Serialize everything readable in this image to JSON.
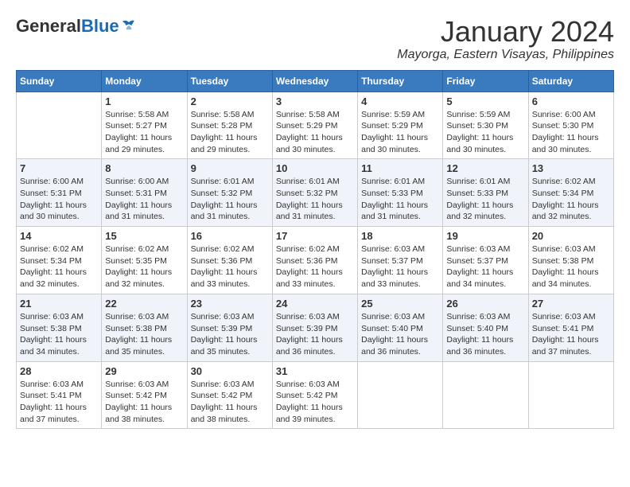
{
  "header": {
    "logo_general": "General",
    "logo_blue": "Blue",
    "month": "January 2024",
    "location": "Mayorga, Eastern Visayas, Philippines"
  },
  "days_of_week": [
    "Sunday",
    "Monday",
    "Tuesday",
    "Wednesday",
    "Thursday",
    "Friday",
    "Saturday"
  ],
  "weeks": [
    [
      {
        "day": "",
        "sunrise": "",
        "sunset": "",
        "daylight": ""
      },
      {
        "day": "1",
        "sunrise": "Sunrise: 5:58 AM",
        "sunset": "Sunset: 5:27 PM",
        "daylight": "Daylight: 11 hours and 29 minutes."
      },
      {
        "day": "2",
        "sunrise": "Sunrise: 5:58 AM",
        "sunset": "Sunset: 5:28 PM",
        "daylight": "Daylight: 11 hours and 29 minutes."
      },
      {
        "day": "3",
        "sunrise": "Sunrise: 5:58 AM",
        "sunset": "Sunset: 5:29 PM",
        "daylight": "Daylight: 11 hours and 30 minutes."
      },
      {
        "day": "4",
        "sunrise": "Sunrise: 5:59 AM",
        "sunset": "Sunset: 5:29 PM",
        "daylight": "Daylight: 11 hours and 30 minutes."
      },
      {
        "day": "5",
        "sunrise": "Sunrise: 5:59 AM",
        "sunset": "Sunset: 5:30 PM",
        "daylight": "Daylight: 11 hours and 30 minutes."
      },
      {
        "day": "6",
        "sunrise": "Sunrise: 6:00 AM",
        "sunset": "Sunset: 5:30 PM",
        "daylight": "Daylight: 11 hours and 30 minutes."
      }
    ],
    [
      {
        "day": "7",
        "sunrise": "Sunrise: 6:00 AM",
        "sunset": "Sunset: 5:31 PM",
        "daylight": "Daylight: 11 hours and 30 minutes."
      },
      {
        "day": "8",
        "sunrise": "Sunrise: 6:00 AM",
        "sunset": "Sunset: 5:31 PM",
        "daylight": "Daylight: 11 hours and 31 minutes."
      },
      {
        "day": "9",
        "sunrise": "Sunrise: 6:01 AM",
        "sunset": "Sunset: 5:32 PM",
        "daylight": "Daylight: 11 hours and 31 minutes."
      },
      {
        "day": "10",
        "sunrise": "Sunrise: 6:01 AM",
        "sunset": "Sunset: 5:32 PM",
        "daylight": "Daylight: 11 hours and 31 minutes."
      },
      {
        "day": "11",
        "sunrise": "Sunrise: 6:01 AM",
        "sunset": "Sunset: 5:33 PM",
        "daylight": "Daylight: 11 hours and 31 minutes."
      },
      {
        "day": "12",
        "sunrise": "Sunrise: 6:01 AM",
        "sunset": "Sunset: 5:33 PM",
        "daylight": "Daylight: 11 hours and 32 minutes."
      },
      {
        "day": "13",
        "sunrise": "Sunrise: 6:02 AM",
        "sunset": "Sunset: 5:34 PM",
        "daylight": "Daylight: 11 hours and 32 minutes."
      }
    ],
    [
      {
        "day": "14",
        "sunrise": "Sunrise: 6:02 AM",
        "sunset": "Sunset: 5:34 PM",
        "daylight": "Daylight: 11 hours and 32 minutes."
      },
      {
        "day": "15",
        "sunrise": "Sunrise: 6:02 AM",
        "sunset": "Sunset: 5:35 PM",
        "daylight": "Daylight: 11 hours and 32 minutes."
      },
      {
        "day": "16",
        "sunrise": "Sunrise: 6:02 AM",
        "sunset": "Sunset: 5:36 PM",
        "daylight": "Daylight: 11 hours and 33 minutes."
      },
      {
        "day": "17",
        "sunrise": "Sunrise: 6:02 AM",
        "sunset": "Sunset: 5:36 PM",
        "daylight": "Daylight: 11 hours and 33 minutes."
      },
      {
        "day": "18",
        "sunrise": "Sunrise: 6:03 AM",
        "sunset": "Sunset: 5:37 PM",
        "daylight": "Daylight: 11 hours and 33 minutes."
      },
      {
        "day": "19",
        "sunrise": "Sunrise: 6:03 AM",
        "sunset": "Sunset: 5:37 PM",
        "daylight": "Daylight: 11 hours and 34 minutes."
      },
      {
        "day": "20",
        "sunrise": "Sunrise: 6:03 AM",
        "sunset": "Sunset: 5:38 PM",
        "daylight": "Daylight: 11 hours and 34 minutes."
      }
    ],
    [
      {
        "day": "21",
        "sunrise": "Sunrise: 6:03 AM",
        "sunset": "Sunset: 5:38 PM",
        "daylight": "Daylight: 11 hours and 34 minutes."
      },
      {
        "day": "22",
        "sunrise": "Sunrise: 6:03 AM",
        "sunset": "Sunset: 5:38 PM",
        "daylight": "Daylight: 11 hours and 35 minutes."
      },
      {
        "day": "23",
        "sunrise": "Sunrise: 6:03 AM",
        "sunset": "Sunset: 5:39 PM",
        "daylight": "Daylight: 11 hours and 35 minutes."
      },
      {
        "day": "24",
        "sunrise": "Sunrise: 6:03 AM",
        "sunset": "Sunset: 5:39 PM",
        "daylight": "Daylight: 11 hours and 36 minutes."
      },
      {
        "day": "25",
        "sunrise": "Sunrise: 6:03 AM",
        "sunset": "Sunset: 5:40 PM",
        "daylight": "Daylight: 11 hours and 36 minutes."
      },
      {
        "day": "26",
        "sunrise": "Sunrise: 6:03 AM",
        "sunset": "Sunset: 5:40 PM",
        "daylight": "Daylight: 11 hours and 36 minutes."
      },
      {
        "day": "27",
        "sunrise": "Sunrise: 6:03 AM",
        "sunset": "Sunset: 5:41 PM",
        "daylight": "Daylight: 11 hours and 37 minutes."
      }
    ],
    [
      {
        "day": "28",
        "sunrise": "Sunrise: 6:03 AM",
        "sunset": "Sunset: 5:41 PM",
        "daylight": "Daylight: 11 hours and 37 minutes."
      },
      {
        "day": "29",
        "sunrise": "Sunrise: 6:03 AM",
        "sunset": "Sunset: 5:42 PM",
        "daylight": "Daylight: 11 hours and 38 minutes."
      },
      {
        "day": "30",
        "sunrise": "Sunrise: 6:03 AM",
        "sunset": "Sunset: 5:42 PM",
        "daylight": "Daylight: 11 hours and 38 minutes."
      },
      {
        "day": "31",
        "sunrise": "Sunrise: 6:03 AM",
        "sunset": "Sunset: 5:42 PM",
        "daylight": "Daylight: 11 hours and 39 minutes."
      },
      {
        "day": "",
        "sunrise": "",
        "sunset": "",
        "daylight": ""
      },
      {
        "day": "",
        "sunrise": "",
        "sunset": "",
        "daylight": ""
      },
      {
        "day": "",
        "sunrise": "",
        "sunset": "",
        "daylight": ""
      }
    ]
  ]
}
